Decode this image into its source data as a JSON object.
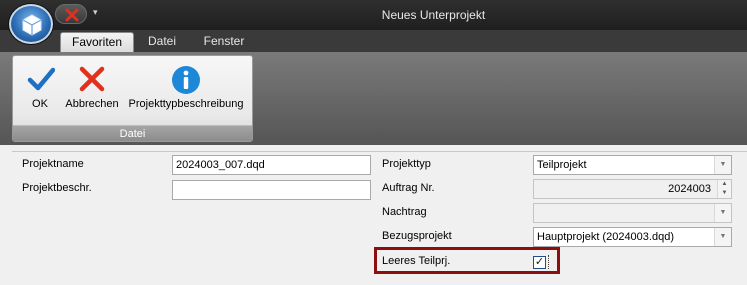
{
  "window": {
    "title": "Neues Unterprojekt"
  },
  "qat": {
    "dropdown_glyph": "▾"
  },
  "ribbon": {
    "tabs": [
      {
        "label": "Favoriten",
        "active": true
      },
      {
        "label": "Datei",
        "active": false
      },
      {
        "label": "Fenster",
        "active": false
      }
    ],
    "group": {
      "label": "Datei",
      "buttons": [
        {
          "label": "OK",
          "icon": "checkmark-icon"
        },
        {
          "label": "Abbrechen",
          "icon": "cancel-x-icon"
        },
        {
          "label": "Projekttypbeschreibung",
          "icon": "info-icon"
        }
      ]
    }
  },
  "form": {
    "projektname": {
      "label": "Projektname",
      "value": "2024003_007.dqd"
    },
    "projektbeschr": {
      "label": "Projektbeschr.",
      "value": ""
    },
    "projekttyp": {
      "label": "Projekttyp",
      "value": "Teilprojekt"
    },
    "auftrag_nr": {
      "label": "Auftrag Nr.",
      "value": "2024003"
    },
    "nachtrag": {
      "label": "Nachtrag",
      "value": ""
    },
    "bezugsprojekt": {
      "label": "Bezugsprojekt",
      "value": "Hauptprojekt (2024003.dqd)"
    },
    "leeres_teilprj": {
      "label": "Leeres Teilprj.",
      "checked": true
    }
  },
  "colors": {
    "highlight_border": "#8b0f0f",
    "ok_blue": "#1f6fc2",
    "cancel_red": "#e0301e",
    "info_blue": "#1e88d8"
  }
}
